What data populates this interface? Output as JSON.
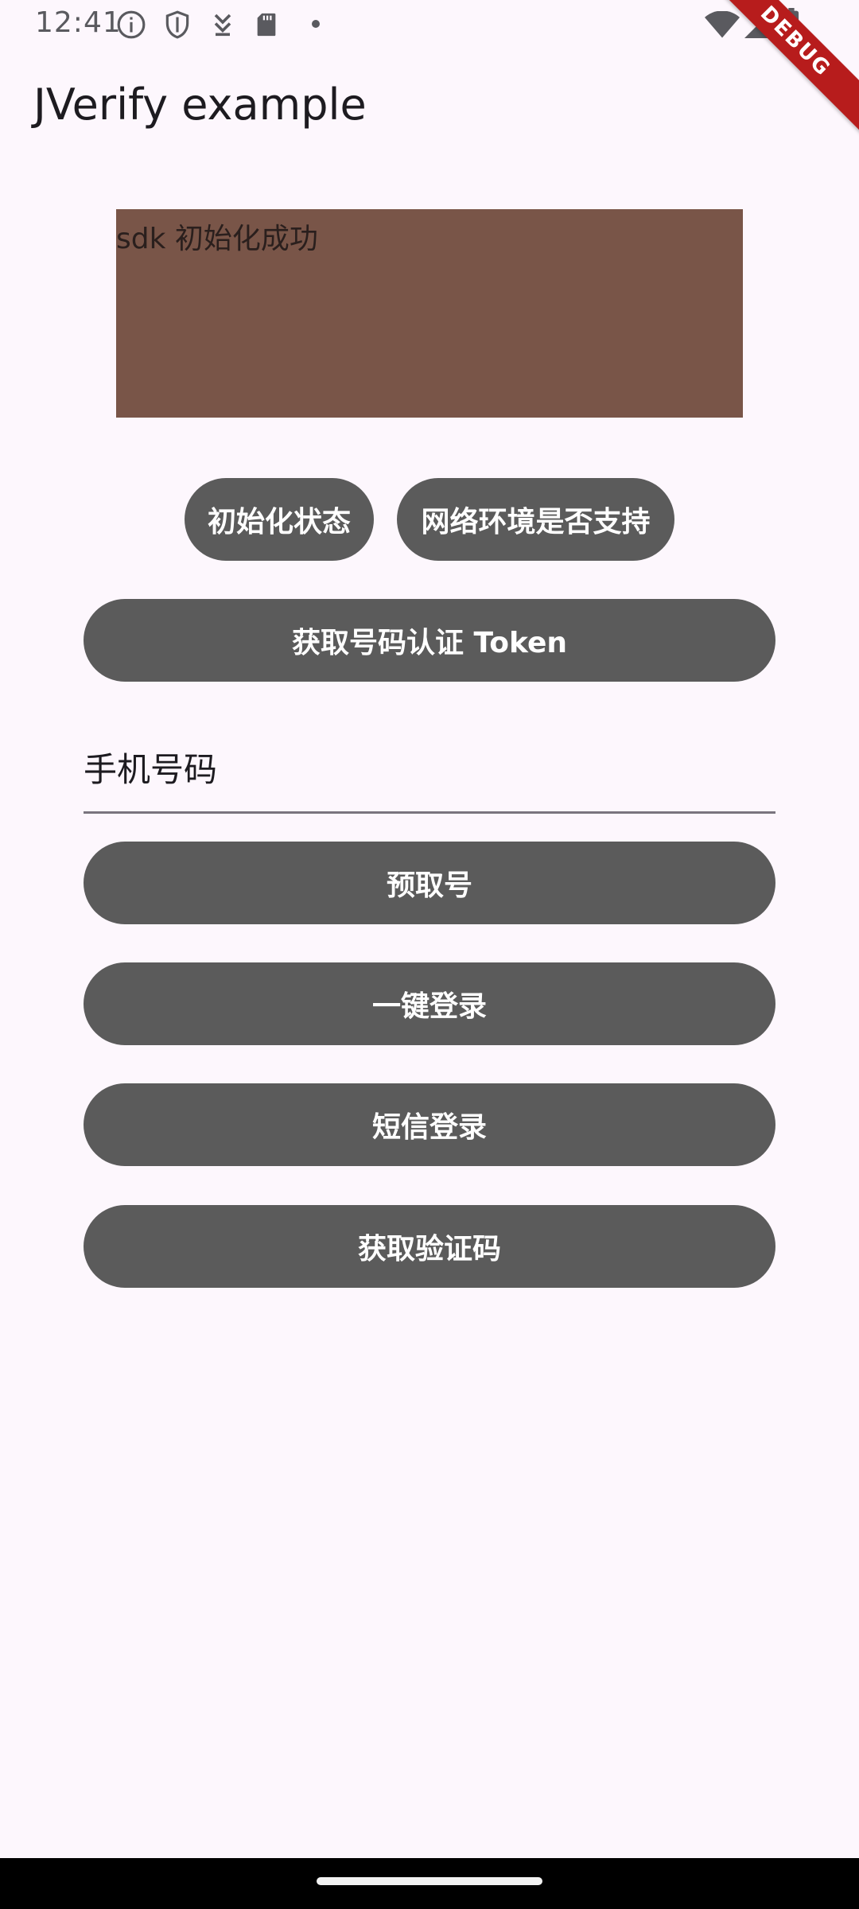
{
  "status_bar": {
    "time": "12:41",
    "icons_left": [
      "info-icon",
      "shield-icon",
      "download-icon",
      "sd-card-icon",
      "dot-icon"
    ],
    "icons_right": [
      "wifi-icon",
      "signal-icon",
      "battery-icon"
    ]
  },
  "debug_banner": {
    "label": "DEBUG"
  },
  "app_bar": {
    "title": "JVerify example"
  },
  "result": {
    "message": "sdk 初始化成功",
    "background_color": "#795548"
  },
  "buttons": {
    "init_status": "初始化状态",
    "network_check": "网络环境是否支持",
    "get_token": "获取号码认证 Token",
    "prefetch_number": "预取号",
    "one_click_login": "一键登录",
    "sms_login": "短信登录",
    "get_verification_code": "获取验证码"
  },
  "phone_input": {
    "label": "手机号码",
    "value": ""
  },
  "colors": {
    "button_bg": "#5b5b5b",
    "page_bg": "#fdf7fd",
    "debug_banner": "#b71c1c"
  }
}
